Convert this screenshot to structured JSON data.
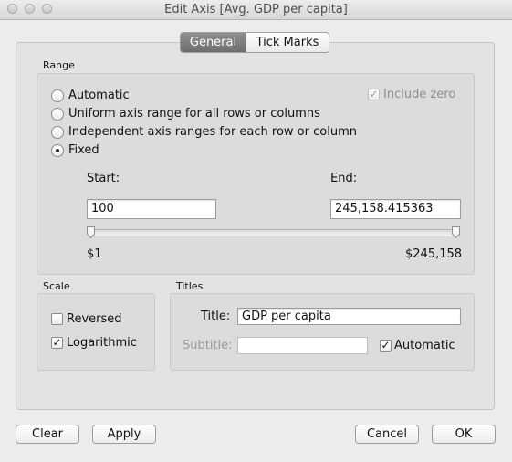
{
  "window": {
    "title": "Edit Axis [Avg. GDP per capita]"
  },
  "tabs": [
    {
      "label": "General",
      "active": true
    },
    {
      "label": "Tick Marks",
      "active": false
    }
  ],
  "range": {
    "group_label": "Range",
    "options": [
      {
        "label": "Automatic",
        "selected": false
      },
      {
        "label": "Uniform axis range for all rows or columns",
        "selected": false
      },
      {
        "label": "Independent axis ranges for each row or column",
        "selected": false
      },
      {
        "label": "Fixed",
        "selected": true
      }
    ],
    "include_zero": {
      "label": "Include zero",
      "checked": true,
      "enabled": false
    },
    "start_label": "Start:",
    "start_value": "100",
    "end_label": "End:",
    "end_value": "245,158.415363",
    "slider_min_label": "$1",
    "slider_max_label": "$245,158"
  },
  "scale": {
    "group_label": "Scale",
    "reversed": {
      "label": "Reversed",
      "checked": false
    },
    "logarithmic": {
      "label": "Logarithmic",
      "checked": true
    }
  },
  "titles": {
    "group_label": "Titles",
    "title_label": "Title:",
    "title_value": "GDP per capita",
    "subtitle_label": "Subtitle:",
    "subtitle_value": "",
    "automatic": {
      "label": "Automatic",
      "checked": true
    }
  },
  "buttons": {
    "clear": "Clear",
    "apply": "Apply",
    "cancel": "Cancel",
    "ok": "OK"
  },
  "colors": {
    "window_bg": "#ececec",
    "panel_bg": "#e3e3e3",
    "active_tab": "#7d7d7d"
  }
}
